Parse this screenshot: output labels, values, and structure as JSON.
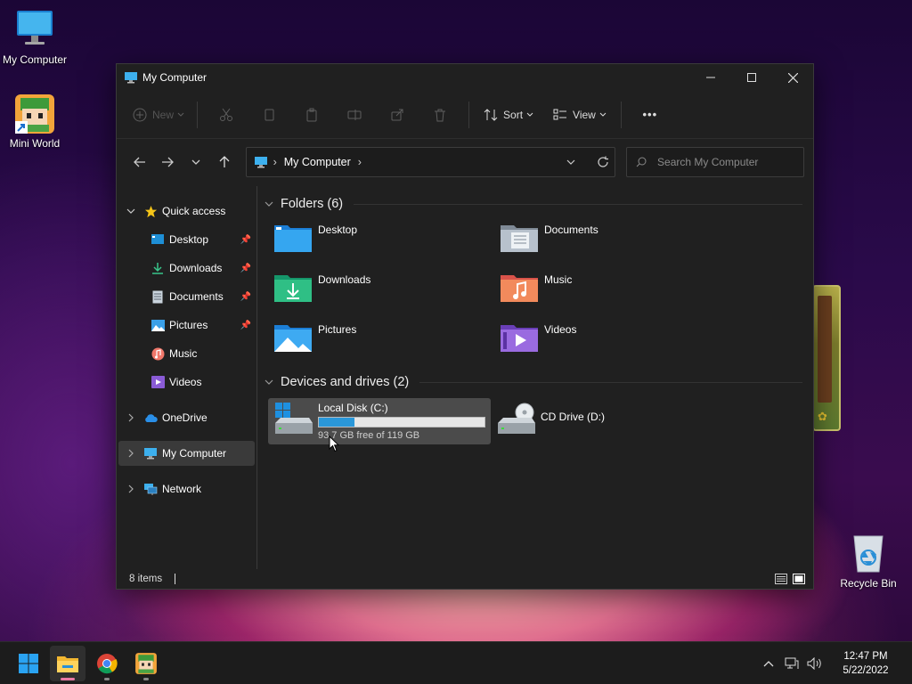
{
  "desktop": {
    "icons": [
      {
        "label": "My Computer",
        "icon": "monitor-icon"
      },
      {
        "label": "Mini World",
        "icon": "mini-world-icon"
      },
      {
        "label": "Recycle Bin",
        "icon": "recycle-bin-icon"
      }
    ]
  },
  "window": {
    "title": "My Computer",
    "controls": {
      "minimize": "—",
      "maximize": "☐",
      "close": "✕"
    }
  },
  "commandbar": {
    "new_label": "New",
    "sort_label": "Sort",
    "view_label": "View",
    "more_label": "•••"
  },
  "address": {
    "location": "My Computer"
  },
  "search": {
    "placeholder": "Search My Computer"
  },
  "navpane": {
    "quick_access": "Quick access",
    "pinned": [
      {
        "label": "Desktop",
        "icon": "desktop-folder-icon",
        "pinned": true
      },
      {
        "label": "Downloads",
        "icon": "download-icon",
        "pinned": true
      },
      {
        "label": "Documents",
        "icon": "document-icon",
        "pinned": true
      },
      {
        "label": "Pictures",
        "icon": "pictures-icon",
        "pinned": true
      },
      {
        "label": "Music",
        "icon": "music-icon",
        "pinned": false
      },
      {
        "label": "Videos",
        "icon": "videos-icon",
        "pinned": false
      }
    ],
    "onedrive": "OneDrive",
    "my_computer": "My Computer",
    "network": "Network"
  },
  "content": {
    "folders_heading": "Folders (6)",
    "folders": [
      {
        "name": "Desktop"
      },
      {
        "name": "Documents"
      },
      {
        "name": "Downloads"
      },
      {
        "name": "Music"
      },
      {
        "name": "Pictures"
      },
      {
        "name": "Videos"
      }
    ],
    "drives_heading": "Devices and drives (2)",
    "drives": [
      {
        "name": "Local Disk (C:)",
        "free_text": "93.7 GB free of 119 GB",
        "used_fraction": 0.213
      },
      {
        "name": "CD Drive (D:)"
      }
    ]
  },
  "status": {
    "items": "8 items"
  },
  "taskbar": {
    "time": "12:47 PM",
    "date": "5/22/2022"
  },
  "colors": {
    "accent": "#2a97d9",
    "window_bg": "#202020",
    "selection": "#3a3a3a",
    "taskbar_indicator": "#e879a3"
  }
}
